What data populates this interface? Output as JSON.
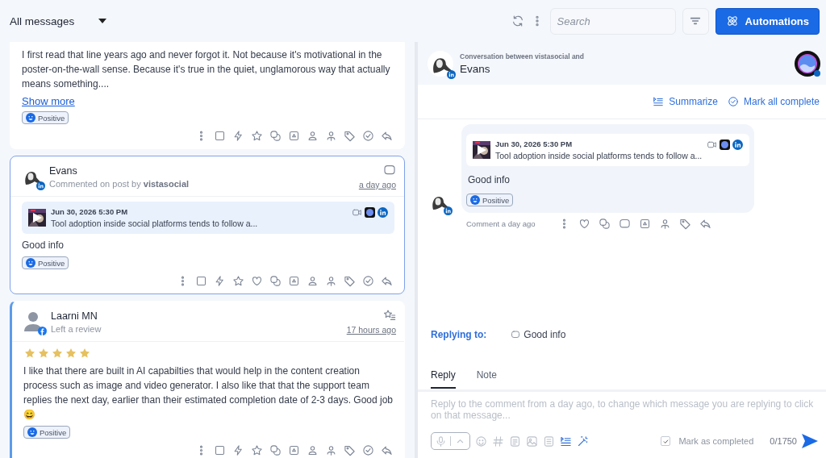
{
  "toolbar": {
    "filter_label": "All messages",
    "search": {
      "placeholder": "Search"
    },
    "automations_button": "Automations"
  },
  "messages": [
    {
      "kind": "post",
      "selected": false,
      "unread": false,
      "can_like": false,
      "body": "I first read that line years ago and never forgot it. Not because it's motivational in the poster-on-the-wall sense. Because it's true in the quiet, unglamorous way that actually means something....",
      "show_more": "Show more",
      "sentiment": "Positive"
    },
    {
      "kind": "comment",
      "selected": true,
      "unread": false,
      "can_like": true,
      "author": "Evans",
      "subtitle": "Commented on post by **vistasocial**",
      "time": "a day ago",
      "post": {
        "date": "Jun 30, 2026 5:30 PM",
        "excerpt": "Tool adoption inside social platforms tends to follow a..."
      },
      "body": "Good info",
      "sentiment": "Positive"
    },
    {
      "kind": "review",
      "selected": false,
      "unread": true,
      "can_like": false,
      "author": "Laarni MN",
      "subtitle": "Left a review",
      "time": "17 hours ago",
      "stars": 5,
      "body": "I like that there are built in AI capabilties that would help in the content creation process such as image and video generator. I also like that that the support team replies the next day, earlier than their estimated completion date of 2-3 days. Good job😄",
      "sentiment": "Positive"
    }
  ],
  "conversation": {
    "caption": "Conversation between vistasocial and",
    "name": "Evans",
    "summarize": "Summarize",
    "mark_all": "Mark all complete",
    "message": {
      "post": {
        "date": "Jun 30, 2026 5:30 PM",
        "excerpt": "Tool adoption inside social platforms tends to follow a..."
      },
      "body": "Good info",
      "sentiment": "Positive",
      "meta": "Comment a day ago"
    },
    "replying_to_label": "Replying to:",
    "replying_to": "Good info",
    "tabs": [
      {
        "label": "Reply",
        "selected": true
      },
      {
        "label": "Note",
        "selected": false
      }
    ],
    "composer": {
      "placeholder": "Reply to the comment from a day ago, to change which message you are replying to click on that message...",
      "mark_completed": {
        "label": "Mark as completed",
        "checked": true
      },
      "counter": "0/1750"
    }
  }
}
